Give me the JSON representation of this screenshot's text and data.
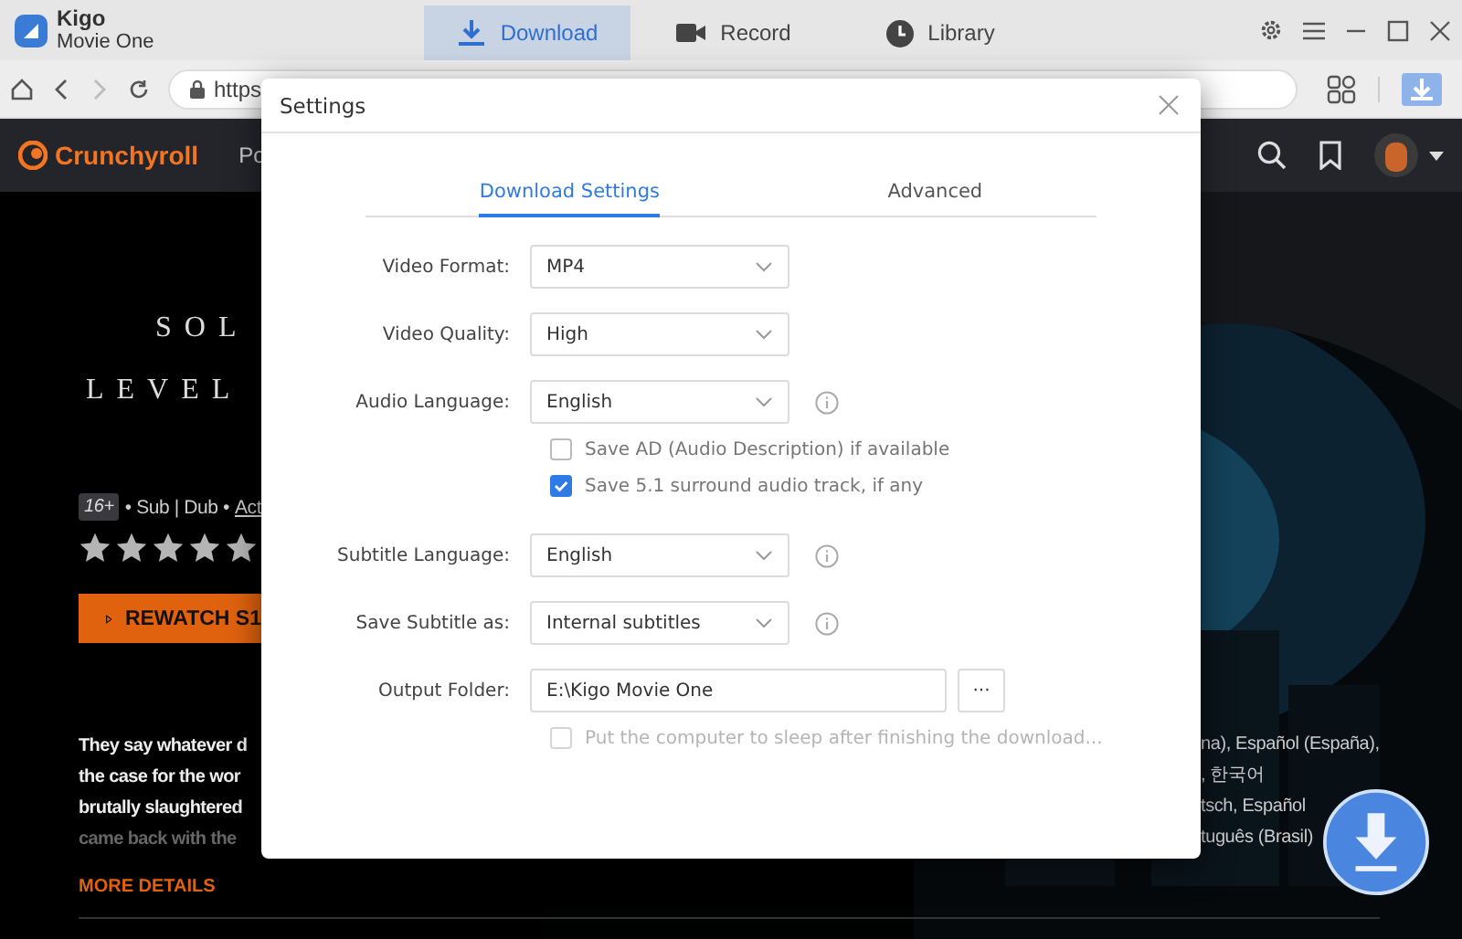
{
  "app": {
    "name": "Kigo",
    "subtitle": "Movie One",
    "tabs": [
      {
        "label": "Download",
        "selected": true
      },
      {
        "label": "Record",
        "selected": false
      },
      {
        "label": "Library",
        "selected": false
      }
    ]
  },
  "address_bar": {
    "url": "https",
    "forward_disabled": true
  },
  "site": {
    "brand": "Crunchyroll",
    "nav_items": [
      "Po"
    ]
  },
  "show": {
    "title_lines": [
      "SOL",
      "LEVEL"
    ],
    "rating_badge": "16+",
    "meta": "• Sub | Dub •",
    "genre_link": "Act",
    "stars": 5,
    "watch_button": "REWATCH S1",
    "description_lines": [
      "They say whatever d",
      "the case for the wor",
      "brutally slaughtered",
      "came back with the"
    ],
    "more_details": "MORE DETAILS",
    "language_lines": [
      "na), Español (España),",
      ", 한국어",
      "tsch, Español",
      "tuguês (Brasil)"
    ]
  },
  "settings": {
    "title": "Settings",
    "tabs": [
      {
        "label": "Download Settings",
        "selected": true
      },
      {
        "label": "Advanced",
        "selected": false
      }
    ],
    "rows": [
      {
        "kind": "select",
        "label": "Video Format:",
        "value": "MP4",
        "info": false
      },
      {
        "kind": "select",
        "label": "Video Quality:",
        "value": "High",
        "info": false
      },
      {
        "kind": "select",
        "label": "Audio Language:",
        "value": "English",
        "info": true
      },
      {
        "kind": "checkbox",
        "label": "Save AD (Audio Description) if available",
        "checked": false,
        "disabled": false
      },
      {
        "kind": "checkbox",
        "label": "Save 5.1 surround audio track, if any",
        "checked": true,
        "disabled": false
      },
      {
        "kind": "select",
        "label": "Subtitle Language:",
        "value": "English",
        "info": true
      },
      {
        "kind": "select",
        "label": "Save Subtitle as:",
        "value": "Internal subtitles",
        "info": true
      },
      {
        "kind": "folder",
        "label": "Output Folder:",
        "value": "E:\\Kigo Movie One",
        "button": "···"
      },
      {
        "kind": "checkbox",
        "label": "Put the computer to sleep after finishing the download...",
        "checked": false,
        "disabled": true
      }
    ]
  }
}
